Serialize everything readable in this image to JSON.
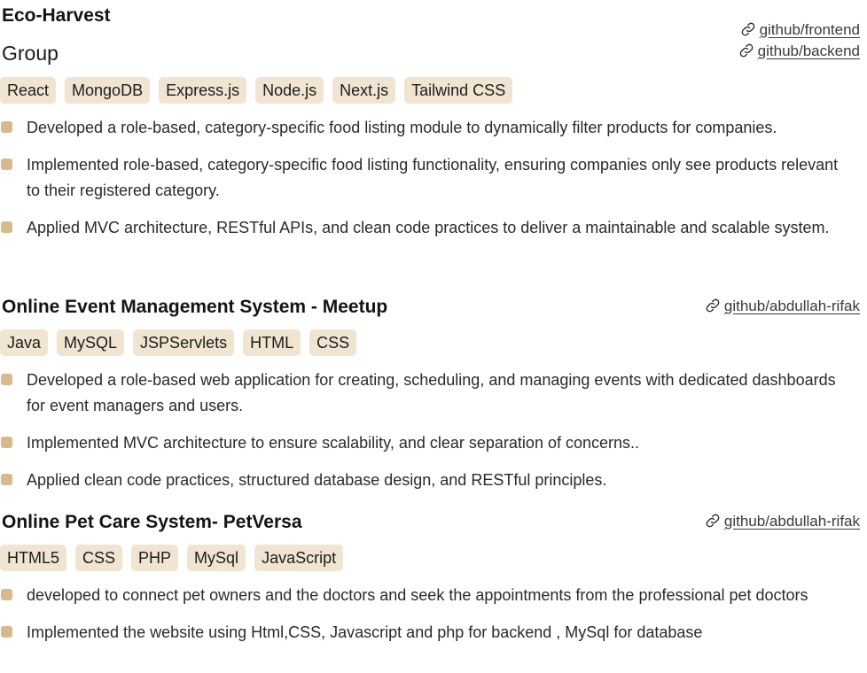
{
  "projects": [
    {
      "title": "Eco-Harvest",
      "subtitle": "Group",
      "links": [
        "github/frontend",
        "github/backend"
      ],
      "tags": [
        "React",
        "MongoDB",
        "Express.js",
        "Node.js",
        "Next.js",
        "Tailwind CSS"
      ],
      "bullets": [
        "Developed a role-based, category-specific food listing module to dynamically filter products for companies.",
        "Implemented role-based, category-specific food listing functionality, ensuring companies only see products relevant to their registered category.",
        "Applied MVC architecture, RESTful APIs, and clean code practices to deliver a maintainable and scalable system."
      ]
    },
    {
      "title": "Online Event Management  System - Meetup",
      "links": [
        "github/abdullah-rifak"
      ],
      "tags": [
        "Java",
        "MySQL",
        "JSPServlets",
        "HTML",
        "CSS"
      ],
      "bullets": [
        "Developed a role-based web application for creating, scheduling, and managing events with dedicated dashboards for event managers and users.",
        "Implemented MVC architecture to ensure scalability, and clear separation of concerns..",
        "Applied clean code practices, structured database design, and RESTful principles."
      ]
    },
    {
      "title": "Online Pet Care System- PetVersa",
      "links": [
        "github/abdullah-rifak"
      ],
      "tags": [
        "HTML5",
        "CSS",
        "PHP",
        "MySql",
        "JavaScript"
      ],
      "bullets": [
        "developed to connect pet owners and the doctors and  seek the appointments from the professional pet doctors",
        "Implemented the website using Html,CSS, Javascript and php for backend , MySql for database"
      ]
    }
  ],
  "colors": {
    "tag_bg": "#f1e5d1",
    "bullet": "#d9b98c",
    "text": "#1a1a1a"
  },
  "icons": {
    "link": "link-icon"
  }
}
